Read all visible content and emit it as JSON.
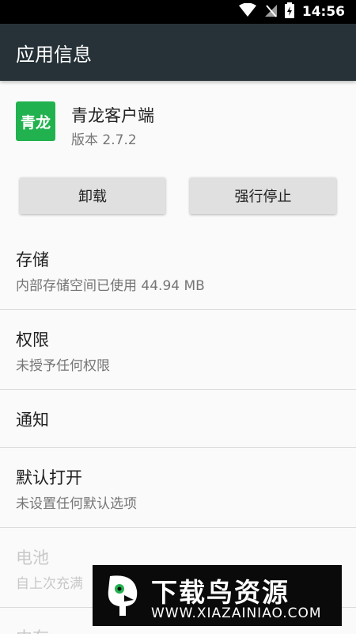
{
  "status_bar": {
    "time": "14:56",
    "icons": [
      "wifi-icon",
      "no-signal-icon",
      "battery-charging-icon"
    ]
  },
  "app_bar": {
    "title": "应用信息"
  },
  "app": {
    "icon_text": "青龙",
    "name": "青龙客户端",
    "version": "版本 2.7.2",
    "icon_color": "#21b24f"
  },
  "buttons": {
    "uninstall": "卸载",
    "force_stop": "强行停止"
  },
  "items": [
    {
      "title": "存储",
      "subtitle": "内部存储空间已使用 44.94 MB"
    },
    {
      "title": "权限",
      "subtitle": "未授予任何权限"
    },
    {
      "title": "通知"
    },
    {
      "title": "默认打开",
      "subtitle": "未设置任何默认选项"
    },
    {
      "title": "电池",
      "subtitle": "自上次充满"
    },
    {
      "title": "内存"
    }
  ],
  "watermark": {
    "title": "下载鸟资源",
    "url": "WWW.XIAZAINIAO.COM"
  },
  "colors": {
    "app_bar": "#263238",
    "status_bar": "#000000",
    "background": "#fafafa"
  }
}
